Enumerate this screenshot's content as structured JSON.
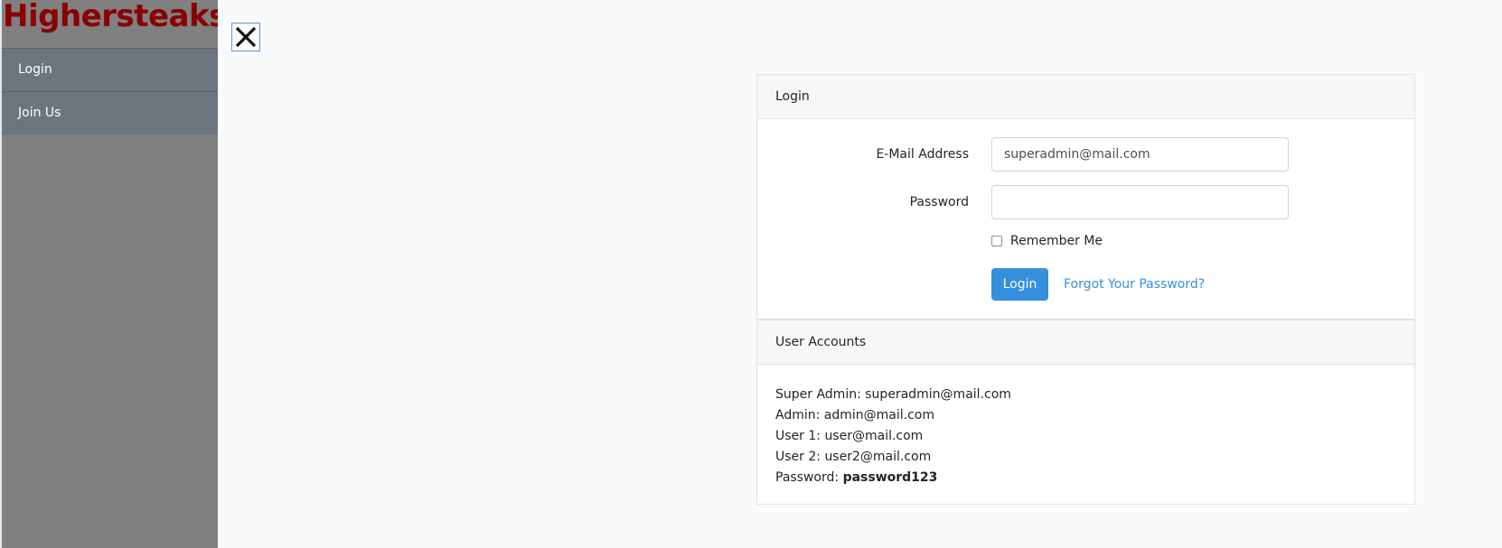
{
  "brand": {
    "name": "Highersteaks"
  },
  "sidebar": {
    "items": [
      {
        "label": "Login"
      },
      {
        "label": "Join Us"
      }
    ]
  },
  "close_button": {
    "icon": "close-icon"
  },
  "login_card": {
    "header": "Login",
    "email": {
      "label": "E-Mail Address",
      "value": "superadmin@mail.com",
      "placeholder": ""
    },
    "password": {
      "label": "Password",
      "value": "",
      "placeholder": ""
    },
    "remember": {
      "label": "Remember Me",
      "checked": false
    },
    "submit_label": "Login",
    "forgot_label": "Forgot Your Password?"
  },
  "accounts_card": {
    "header": "User Accounts",
    "lines": [
      {
        "label": "Super Admin:",
        "value": "superadmin@mail.com"
      },
      {
        "label": "Admin:",
        "value": "admin@mail.com"
      },
      {
        "label": "User 1:",
        "value": "user@mail.com"
      },
      {
        "label": "User 2:",
        "value": "user2@mail.com"
      }
    ],
    "password": {
      "label": "Password:",
      "value": "password123"
    }
  },
  "colors": {
    "brand": "#8b0000",
    "sidebar": "#808080",
    "nav_item": "#6c757d",
    "primary": "#3490dc",
    "page_background": "#f8fafc"
  }
}
